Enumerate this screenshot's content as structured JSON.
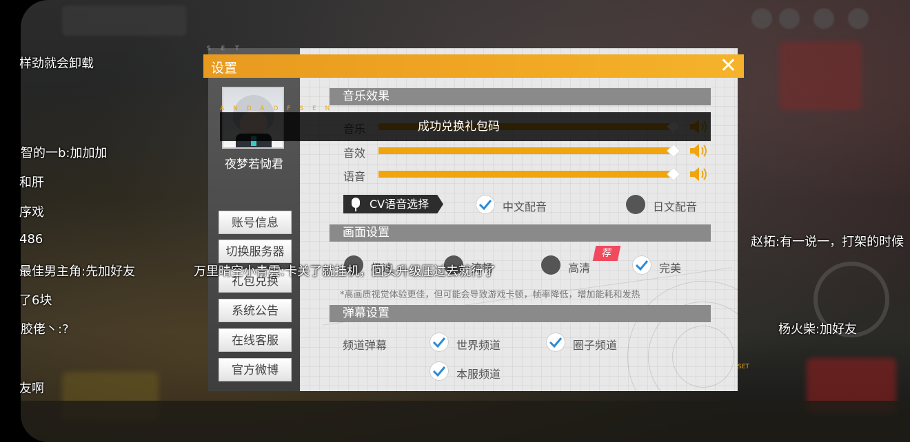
{
  "settings": {
    "title": "设置",
    "close_icon": "close-icon",
    "deco_top": "S E T",
    "deco_side": "SET",
    "player_name": "夜梦若恸君",
    "sidebar_buttons": [
      "账号信息",
      "切换服务器",
      "礼包兑换",
      "系统公告",
      "在线客服",
      "官方微博"
    ],
    "sections": {
      "music": "音乐效果",
      "graphics": "画面设置",
      "danmaku": "弹幕设置"
    },
    "audio": {
      "music_label": "音乐",
      "sfx_label": "音效",
      "voice_label": "语音",
      "music_level": 1.0,
      "sfx_level": 1.0,
      "voice_level": 1.0
    },
    "cv": {
      "tag": "CV语音选择",
      "chinese": "中文配音",
      "japanese": "日文配音",
      "selected": "中文配音"
    },
    "graphics": {
      "options": [
        "极速",
        "流畅",
        "高清",
        "完美"
      ],
      "selected": "完美",
      "recommended_badge": "荐",
      "note": "*高画质视觉体验更佳，但可能会导致游戏卡顿，帧率降低，增加能耗和发热"
    },
    "danmaku": {
      "channel_label": "频道弹幕",
      "world": "世界频道",
      "circle": "圈子频道",
      "server": "本服频道"
    }
  },
  "toast": {
    "message": "成功兑换礼包码",
    "deco": "A N D A O F S E N"
  },
  "danmaku_messages": [
    "样劲就会卸载",
    "智的一b:加加加",
    "和肝",
    "序戏",
    "486",
    "最佳男主角:先加好友",
    "了6块",
    "胶佬丶:?",
    "友啊",
    "万里晴空小青雲:卡关了就挂机，回头升级压过去就行了",
    "赵拓:有一说一，打架的时候",
    "杨火柴:加好友"
  ],
  "colors": {
    "accent": "#f0a40e",
    "header": "#f1a823",
    "section": "#8a8a8a",
    "badge": "#f04a5e",
    "check": "#2a8bd8"
  }
}
